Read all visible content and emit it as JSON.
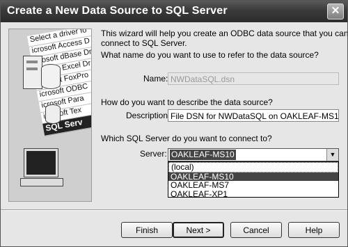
{
  "window": {
    "title": "Create a New Data Source to SQL Server",
    "close_glyph": "✕"
  },
  "art": {
    "items": [
      "Select a driver fo",
      "icrosoft Access D",
      "icrosoft dBase Dr",
      "icrosoft Excel Dr",
      "icrosoft FoxPro",
      "icrosoft ODBC",
      "icrosoft Para",
      "icrosoft Tex",
      "SQL Serv"
    ],
    "selected_index": 8,
    "icons": [
      "server-tower-icon",
      "database-icon",
      "database-icon",
      "computer-icon"
    ]
  },
  "wizard": {
    "intro": [
      "This wizard will help you create an ODBC data source that you can use to",
      "connect to SQL Server."
    ],
    "name_question": "What name do you want to use to refer to the data source?",
    "name_label": "Name:",
    "name_value": "NWDataSQL.dsn",
    "desc_question": "How do you want to describe the data source?",
    "desc_label": "Description:",
    "desc_value": "File DSN for NWDataSQL on OAKLEAF-MS10",
    "server_question": "Which SQL Server do you want to connect to?",
    "server_label": "Server:",
    "server_value": "OAKLEAF-MS10",
    "server_options": [
      "(local)",
      "OAKLEAF-MS10",
      "OAKLEAF-MS7",
      "OAKLEAF-XP1"
    ],
    "server_selected_index": 1
  },
  "buttons": {
    "finish": "Finish",
    "next": "Next >",
    "cancel": "Cancel",
    "help": "Help"
  }
}
